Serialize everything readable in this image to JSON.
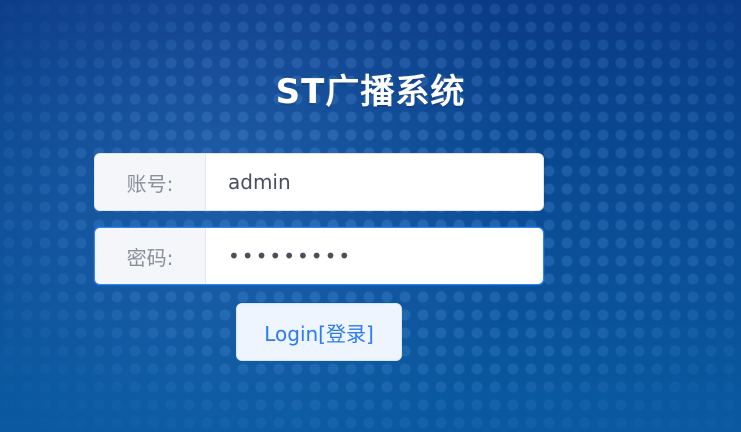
{
  "app": {
    "title": "ST广播系统"
  },
  "login": {
    "username_label": "账号:",
    "username_value": "admin",
    "password_label": "密码:",
    "password_value": "•••••••••",
    "login_button_label": "Login[登录]"
  },
  "colors": {
    "background_primary": "#0b3f84",
    "accent_blue": "#2c7cf0",
    "input_focus_border": "#2c83ff"
  }
}
